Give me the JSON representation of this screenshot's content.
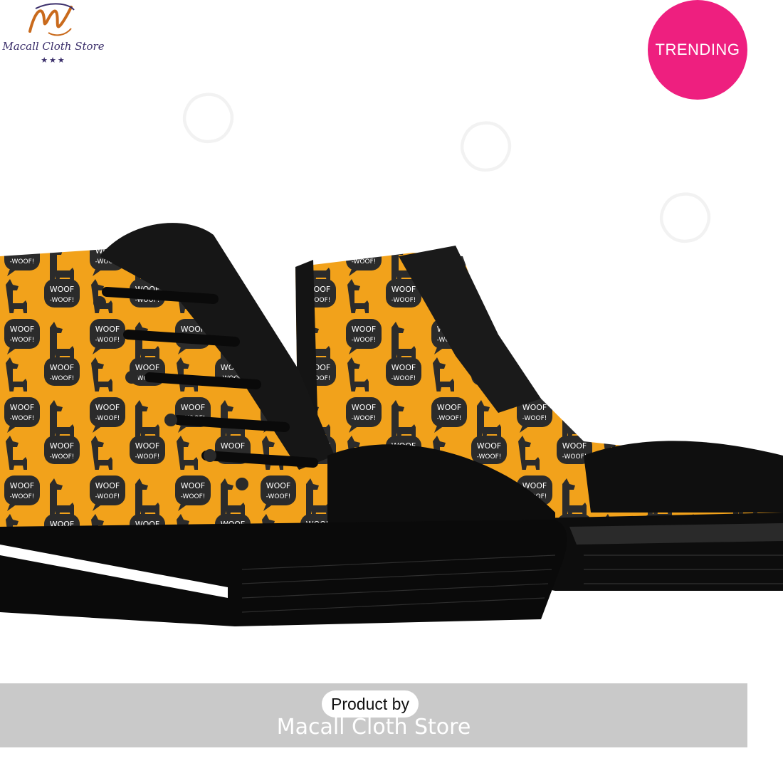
{
  "logo": {
    "monogram": "M",
    "store_name": "Macall Cloth Store",
    "stars": "★★★"
  },
  "badge": {
    "label": "TRENDING",
    "color": "#ee1f7f"
  },
  "product": {
    "print_text_line1": "WOOF",
    "print_text_line2": "-WOOF!",
    "upper_color": "#f2a21b",
    "sole_color": "#0d0d0d"
  },
  "banner": {
    "product_by": "Product by",
    "store_name": "Macall Cloth Store"
  }
}
